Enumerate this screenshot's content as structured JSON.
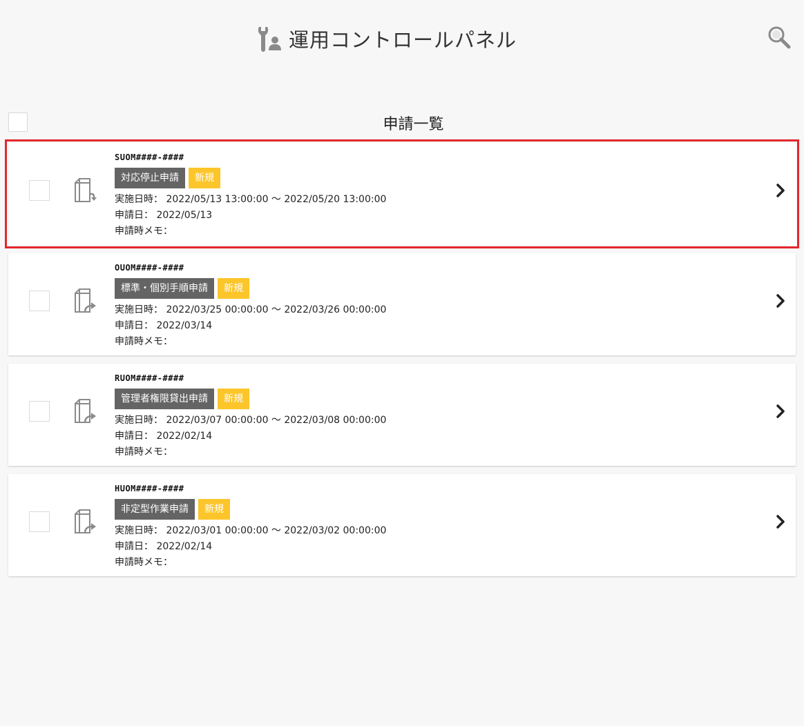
{
  "header": {
    "title": "運用コントロールパネル",
    "app_icon": "wrench-user-icon",
    "search_icon": "search-icon"
  },
  "list": {
    "title": "申請一覧"
  },
  "labels": {
    "date_label": "実施日時：",
    "applied_label": "申請日：",
    "memo_label": "申請時メモ："
  },
  "colors": {
    "highlight": "#e3262d",
    "tag_dark": "#646464",
    "tag_new": "#fcc52a",
    "background": "#f7f7f7"
  },
  "applications": [
    {
      "code": "SUOM####-####",
      "type": "対応停止申請",
      "status": "新規",
      "period": "2022/05/13 13:00:00 〜 2022/05/20 13:00:00",
      "applied_date": "2022/05/13",
      "memo": "",
      "icon": "document-in-icon",
      "selected": true
    },
    {
      "code": "OUOM####-####",
      "type": "標準・個別手順申請",
      "status": "新規",
      "period": "2022/03/25 00:00:00 〜 2022/03/26 00:00:00",
      "applied_date": "2022/03/14",
      "memo": "",
      "icon": "document-out-icon",
      "selected": false
    },
    {
      "code": "RUOM####-####",
      "type": "管理者権限貸出申請",
      "status": "新規",
      "period": "2022/03/07 00:00:00 〜 2022/03/08 00:00:00",
      "applied_date": "2022/02/14",
      "memo": "",
      "icon": "document-out-icon",
      "selected": false
    },
    {
      "code": "HUOM####-####",
      "type": "非定型作業申請",
      "status": "新規",
      "period": "2022/03/01 00:00:00 〜 2022/03/02 00:00:00",
      "applied_date": "2022/02/14",
      "memo": "",
      "icon": "document-out-icon",
      "selected": false
    }
  ]
}
